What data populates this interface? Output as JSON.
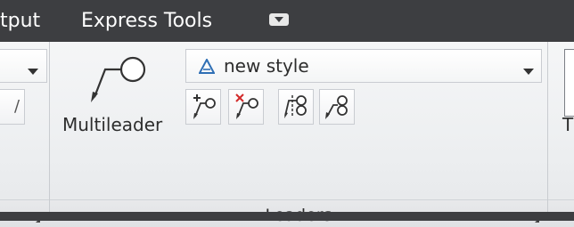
{
  "menu": {
    "items": [
      {
        "label": "tput"
      },
      {
        "label": "Express Tools"
      }
    ]
  },
  "panel": {
    "multileader_label": "Multileader",
    "style_value": "new style",
    "title": "Leaders",
    "right_partial_label": "T",
    "left_partial_label": "/"
  },
  "icons": {
    "style_icon": "leader-style-icon",
    "dropdown_arrow": "chevron-down-icon",
    "add_leader": "add-leader-icon",
    "remove_leader": "remove-leader-icon",
    "align": "align-leaders-icon",
    "collect": "collect-leaders-icon",
    "launcher": "dialog-launcher-icon",
    "workspace": "workspace-toggle-icon"
  },
  "colors": {
    "menubar": "#3d3e41",
    "accent_blue": "#2f6fb5",
    "remove_red": "#d22b2b"
  }
}
